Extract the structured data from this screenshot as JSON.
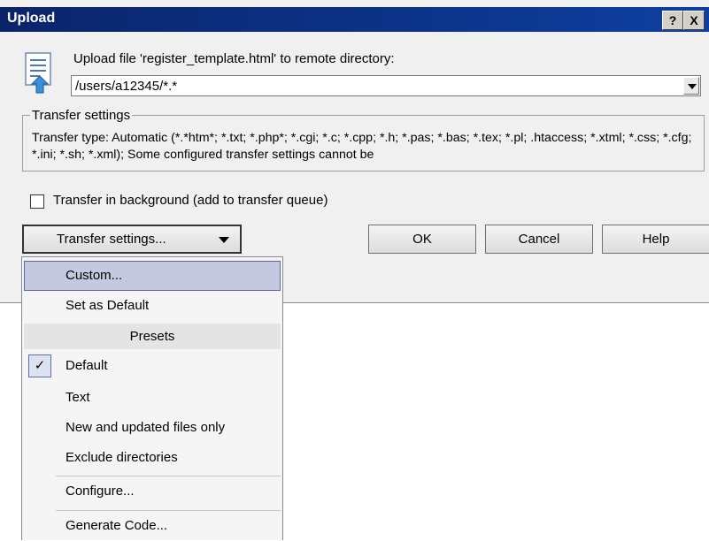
{
  "window": {
    "title": "Upload",
    "help_glyph": "?",
    "close_glyph": "X"
  },
  "upload": {
    "label": "Upload file 'register_template.html' to remote directory:",
    "directory": "/users/a12345/*.*"
  },
  "transfer_group": {
    "legend": "Transfer settings",
    "text": "Transfer type: Automatic (*.*htm*; *.txt; *.php*; *.cgi; *.c; *.cpp; *.h; *.pas; *.bas; *.tex; *.pl; .htaccess; *.xtml; *.css; *.cfg; *.ini; *.sh; *.xml); Some configured transfer settings cannot be"
  },
  "background_checkbox": {
    "label": "Transfer in background (add to transfer queue)",
    "checked": false
  },
  "buttons": {
    "transfer_settings": "Transfer settings...",
    "ok": "OK",
    "cancel": "Cancel",
    "help": "Help"
  },
  "menu": {
    "custom": "Custom...",
    "set_default": "Set as Default",
    "presets_header": "Presets",
    "default": "Default",
    "text": "Text",
    "new_updated": "New and updated files only",
    "exclude_dirs": "Exclude directories",
    "configure": "Configure...",
    "generate_code": "Generate Code...",
    "check_glyph": "✓"
  },
  "colors": {
    "titlebar": "#0a246a",
    "menu_highlight": "#c5c9df",
    "dialog_bg": "#f0f0f0"
  }
}
